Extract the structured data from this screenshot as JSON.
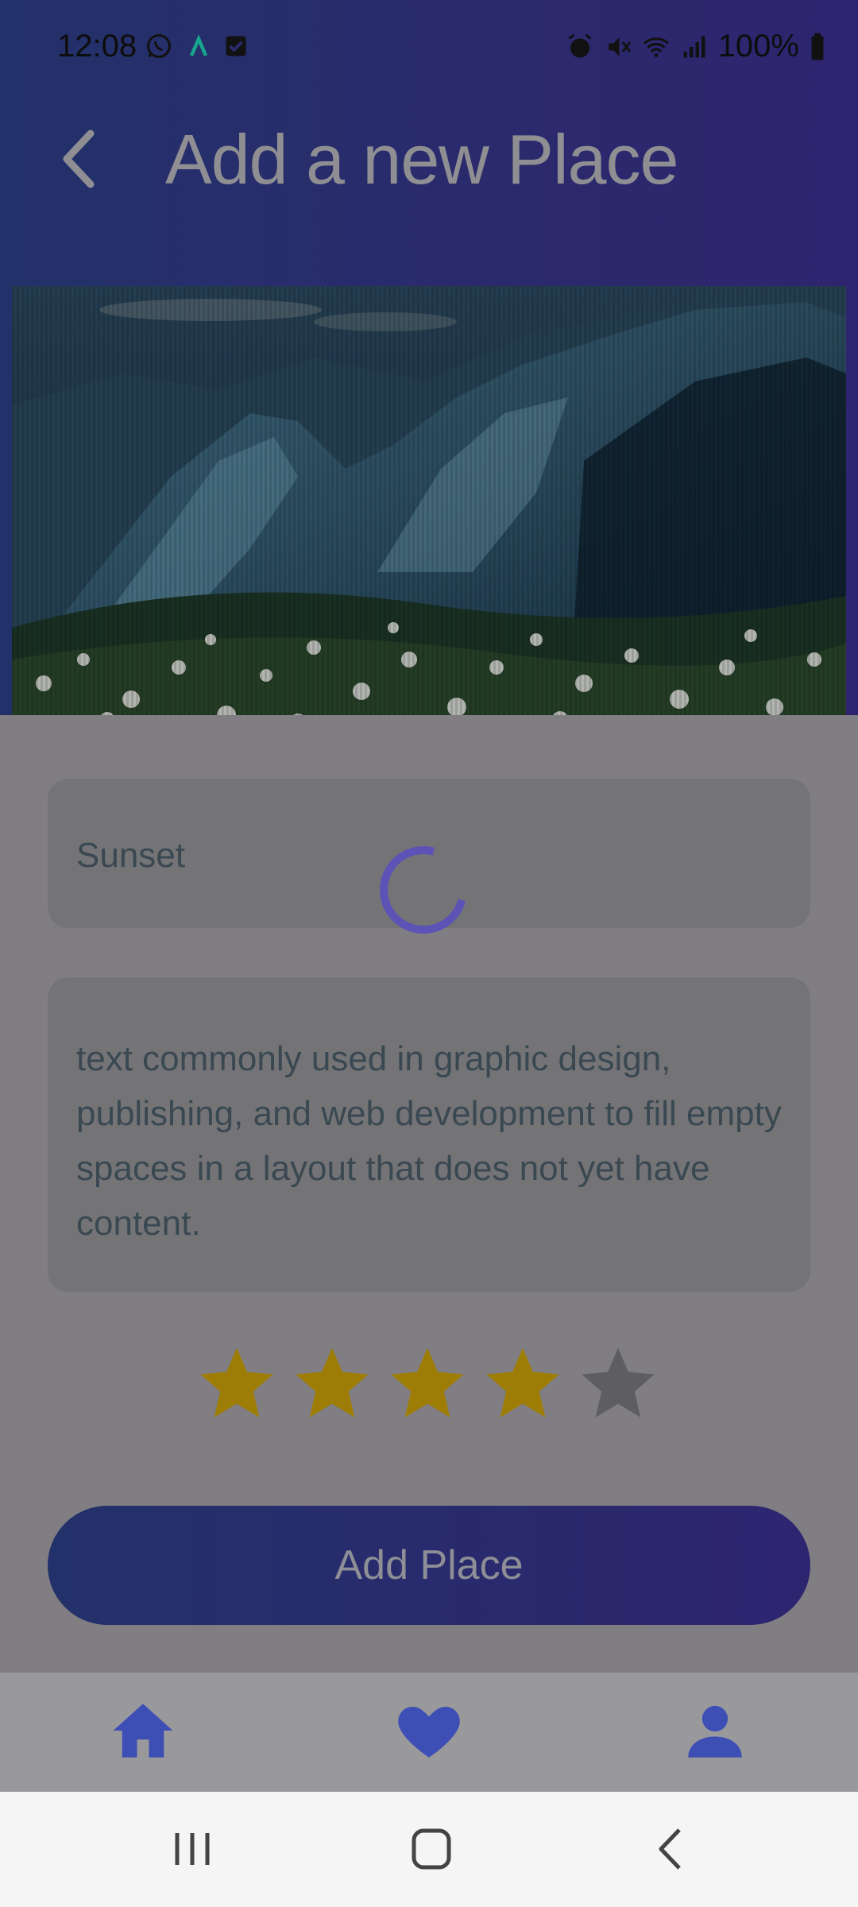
{
  "status_bar": {
    "time": "12:08",
    "battery": "100%",
    "left_icons": [
      "whatsapp-icon",
      "app-icon",
      "checkbox-icon"
    ],
    "right_icons": [
      "alarm-icon",
      "mute-icon",
      "wifi-icon",
      "signal-icon",
      "battery-icon"
    ]
  },
  "header": {
    "title": "Add a new Place",
    "back_icon": "chevron-left-icon"
  },
  "form": {
    "title_value": "Sunset",
    "description_value": "text commonly used in graphic design, publishing, and web development to fill empty spaces in a layout that does not yet have content.",
    "rating": 4,
    "rating_max": 5
  },
  "actions": {
    "add_place_label": "Add Place"
  },
  "bottom_nav": [
    "home-icon",
    "heart-icon",
    "profile-icon"
  ],
  "colors": {
    "header_start": "#23316a",
    "header_end": "#2f2470",
    "star_filled": "#9e7d06",
    "star_empty": "#5e5e60",
    "nav_icon": "#3d4fb5",
    "spinner": "#5d53b6"
  }
}
